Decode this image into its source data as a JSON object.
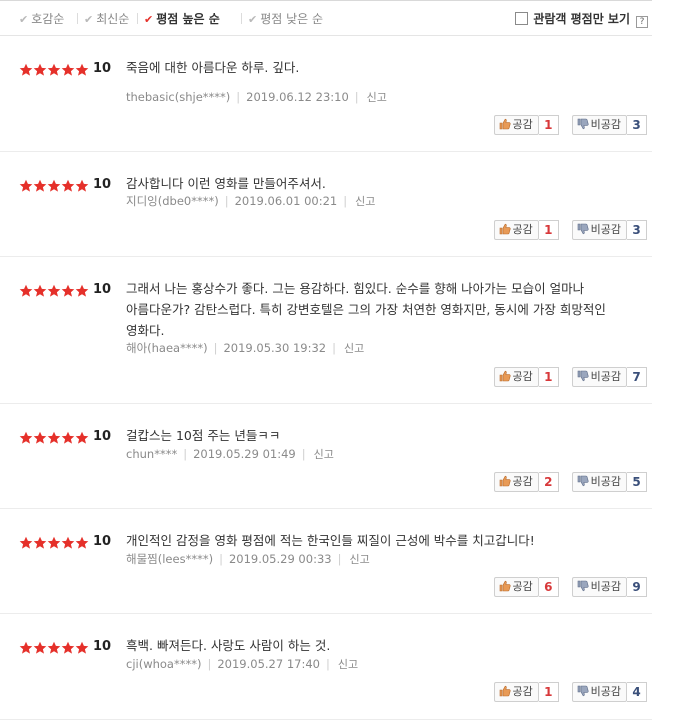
{
  "sort": {
    "options": [
      {
        "label": "호감순",
        "active": false
      },
      {
        "label": "최신순",
        "active": false
      },
      {
        "label": "평점 높은 순",
        "active": true
      },
      {
        "label": "평점 낮은 순",
        "active": false
      }
    ],
    "viewer_only_label": "관람객 평점만 보기",
    "help_label": "?"
  },
  "labels": {
    "report": "신고",
    "like": "공감",
    "dislike": "비공감"
  },
  "colors": {
    "star_fill": "#e5302a",
    "active_check": "#e5302a",
    "like_count": "#d8383a",
    "dislike_count": "#3a4f7a"
  },
  "icons": {
    "check": "check-icon",
    "star": "star-icon",
    "thumb_up": "thumb-up-icon",
    "thumb_down": "thumb-down-icon"
  },
  "reviews": [
    {
      "stars": 5,
      "score": "10",
      "text": "죽음에 대한 아름다운 하루. 깊다.",
      "writer": "thebasic(shje****)",
      "date": "2019.06.12 23:10",
      "likes": "1",
      "dislikes": "3"
    },
    {
      "stars": 5,
      "score": "10",
      "text": "감사합니다 이런 영화를 만들어주셔서.",
      "writer": "지디잉(dbe0****)",
      "date": "2019.06.01 00:21",
      "likes": "1",
      "dislikes": "3"
    },
    {
      "stars": 5,
      "score": "10",
      "text": "그래서 나는 홍상수가 좋다. 그는 용감하다. 힘있다. 순수를 향해 나아가는 모습이 얼마나 아름다운가? 감탄스럽다. 특히 강변호텔은 그의 가장 처연한 영화지만, 동시에 가장 희망적인 영화다.",
      "writer": "해아(haea****)",
      "date": "2019.05.30 19:32",
      "likes": "1",
      "dislikes": "7"
    },
    {
      "stars": 5,
      "score": "10",
      "text": "걸캅스는 10점 주는 년들ㅋㅋ",
      "writer": "chun****",
      "date": "2019.05.29 01:49",
      "likes": "2",
      "dislikes": "5"
    },
    {
      "stars": 5,
      "score": "10",
      "text": "개인적인 감정을 영화 평점에 적는 한국인들 찌질이 근성에 박수를 치고갑니다!",
      "writer": "해물찜(lees****)",
      "date": "2019.05.29 00:33",
      "likes": "6",
      "dislikes": "9"
    },
    {
      "stars": 5,
      "score": "10",
      "text": "흑백. 빠져든다. 사랑도 사람이 하는 것.",
      "writer": "cji(whoa****)",
      "date": "2019.05.27 17:40",
      "likes": "1",
      "dislikes": "4"
    }
  ]
}
